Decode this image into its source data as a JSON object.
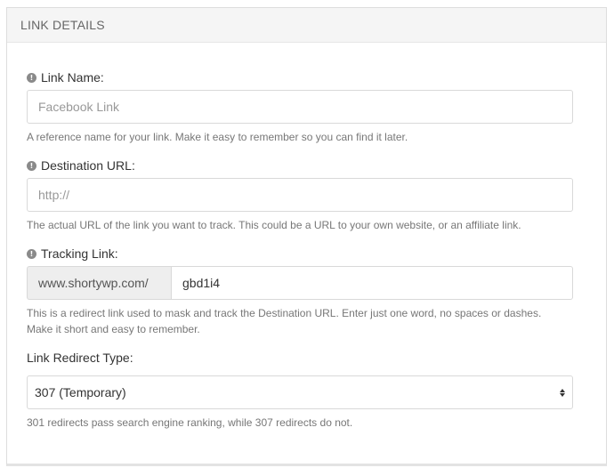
{
  "panel": {
    "title": "LINK DETAILS"
  },
  "link_name": {
    "label": "Link Name:",
    "placeholder": "Facebook Link",
    "value": "",
    "help": "A reference name for your link. Make it easy to remember so you can find it later."
  },
  "destination_url": {
    "label": "Destination URL:",
    "placeholder": "http://",
    "value": "",
    "help": "The actual URL of the link you want to track. This could be a URL to your own website, or an affiliate link."
  },
  "tracking_link": {
    "label": "Tracking Link:",
    "prefix": "www.shortywp.com/",
    "value": "gbd1i4",
    "help_line1": "This is a redirect link used to mask and track the Destination URL. Enter just one word, no spaces or dashes.",
    "help_line2": "Make it short and easy to remember."
  },
  "redirect_type": {
    "label": "Link Redirect Type:",
    "selected": "307 (Temporary)",
    "help": "301 redirects pass search engine ranking, while 307 redirects do not."
  },
  "icons": {
    "info": "info-icon",
    "select": "select-arrows-icon"
  },
  "colors": {
    "header_bg": "#f5f5f5",
    "border": "#d9d9d9",
    "help_text": "#777777",
    "addon_bg": "#eeeeee"
  }
}
